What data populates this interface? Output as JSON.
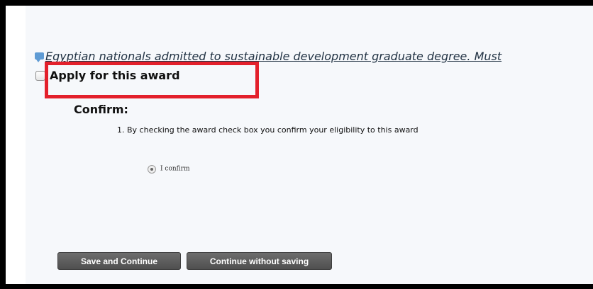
{
  "award": {
    "description": "Egyptian nationals admitted to sustainable development graduate degree. Must",
    "description_icon": "comment-icon",
    "apply_label": "Apply for this award",
    "apply_checked": false
  },
  "confirm": {
    "heading": "Confirm:",
    "items": [
      "1. By checking the award check box you confirm your eligibility to this award"
    ],
    "radio_label": "I confirm",
    "radio_selected": true
  },
  "actions": {
    "save_label": "Save and Continue",
    "continue_label": "Continue without saving"
  },
  "colors": {
    "highlight": "#e3202b",
    "button_bg": "#5a5a5a",
    "icon_blue": "#5f9bd4"
  }
}
